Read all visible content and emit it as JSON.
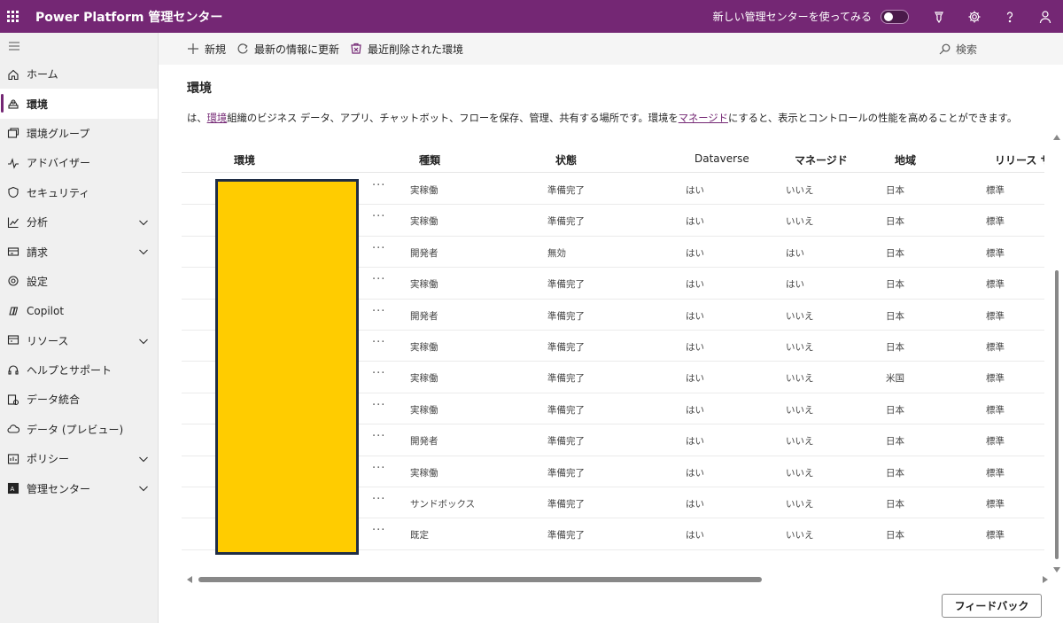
{
  "header": {
    "app_title": "Power Platform 管理センター",
    "new_center_label": "新しい管理センターを使ってみる"
  },
  "sidebar": {
    "items": [
      {
        "label": "ホーム",
        "icon": "home-icon",
        "has_chevron": false,
        "active": false
      },
      {
        "label": "環境",
        "icon": "environment-icon",
        "has_chevron": false,
        "active": true
      },
      {
        "label": "環境グループ",
        "icon": "environment-group-icon",
        "has_chevron": false,
        "active": false
      },
      {
        "label": "アドバイザー",
        "icon": "pulse-icon",
        "has_chevron": false,
        "active": false
      },
      {
        "label": "セキュリティ",
        "icon": "shield-icon",
        "has_chevron": false,
        "active": false
      },
      {
        "label": "分析",
        "icon": "chart-icon",
        "has_chevron": true,
        "active": false
      },
      {
        "label": "請求",
        "icon": "billing-icon",
        "has_chevron": true,
        "active": false
      },
      {
        "label": "設定",
        "icon": "gear-icon",
        "has_chevron": false,
        "active": false
      },
      {
        "label": "Copilot",
        "icon": "copilot-icon",
        "has_chevron": false,
        "active": false
      },
      {
        "label": "リソース",
        "icon": "resources-icon",
        "has_chevron": true,
        "active": false
      },
      {
        "label": "ヘルプとサポート",
        "icon": "headset-icon",
        "has_chevron": false,
        "active": false
      },
      {
        "label": "データ統合",
        "icon": "data-integration-icon",
        "has_chevron": false,
        "active": false
      },
      {
        "label": "データ (プレビュー)",
        "icon": "cloud-data-icon",
        "has_chevron": false,
        "active": false
      },
      {
        "label": "ポリシー",
        "icon": "policy-icon",
        "has_chevron": true,
        "active": false
      },
      {
        "label": "管理センター",
        "icon": "admin-center-icon",
        "has_chevron": true,
        "active": false
      }
    ]
  },
  "commands": {
    "new_label": "新規",
    "refresh_label": "最新の情報に更新",
    "deleted_label": "最近削除された環境",
    "search_label": "検索"
  },
  "main": {
    "title": "環境",
    "desc_prefix": "は、",
    "desc_link1": "環境",
    "desc_mid": "組織のビジネス データ、アプリ、チャットボット、フローを保存、管理、共有する場所です。環境を",
    "desc_link2": "マネージド",
    "desc_suffix": "にすると、表示とコントロールの性能を高めることができます。"
  },
  "table": {
    "headers": {
      "env": "環境",
      "type": "種類",
      "state": "状態",
      "dataverse": "Dataverse",
      "managed": "マネージド",
      "region": "地域",
      "release": "リリース サイ"
    },
    "rows": [
      {
        "type": "実稼働",
        "state": "準備完了",
        "dataverse": "はい",
        "managed": "いいえ",
        "region": "日本",
        "release": "標準"
      },
      {
        "type": "実稼働",
        "state": "準備完了",
        "dataverse": "はい",
        "managed": "いいえ",
        "region": "日本",
        "release": "標準"
      },
      {
        "type": "開発者",
        "state": "無効",
        "dataverse": "はい",
        "managed": "はい",
        "region": "日本",
        "release": "標準"
      },
      {
        "type": "実稼働",
        "state": "準備完了",
        "dataverse": "はい",
        "managed": "はい",
        "region": "日本",
        "release": "標準"
      },
      {
        "type": "開発者",
        "state": "準備完了",
        "dataverse": "はい",
        "managed": "いいえ",
        "region": "日本",
        "release": "標準"
      },
      {
        "type": "実稼働",
        "state": "準備完了",
        "dataverse": "はい",
        "managed": "いいえ",
        "region": "日本",
        "release": "標準"
      },
      {
        "type": "実稼働",
        "state": "準備完了",
        "dataverse": "はい",
        "managed": "いいえ",
        "region": "米国",
        "release": "標準"
      },
      {
        "type": "実稼働",
        "state": "準備完了",
        "dataverse": "はい",
        "managed": "いいえ",
        "region": "日本",
        "release": "標準"
      },
      {
        "type": "開発者",
        "state": "準備完了",
        "dataverse": "はい",
        "managed": "いいえ",
        "region": "日本",
        "release": "標準"
      },
      {
        "type": "実稼働",
        "state": "準備完了",
        "dataverse": "はい",
        "managed": "いいえ",
        "region": "日本",
        "release": "標準"
      },
      {
        "type": "サンドボックス",
        "state": "準備完了",
        "dataverse": "はい",
        "managed": "いいえ",
        "region": "日本",
        "release": "標準"
      },
      {
        "type": "既定",
        "state": "準備完了",
        "dataverse": "はい",
        "managed": "いいえ",
        "region": "日本",
        "release": "標準"
      }
    ],
    "more_label": "···"
  },
  "footer": {
    "feedback_label": "フィードバック"
  },
  "colors": {
    "brand": "#742774",
    "redaction": "#ffcc00"
  }
}
